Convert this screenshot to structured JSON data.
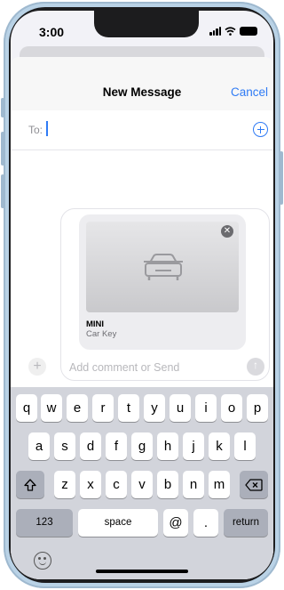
{
  "status_bar": {
    "time": "3:00"
  },
  "header": {
    "title": "New Message",
    "cancel_label": "Cancel"
  },
  "to_field": {
    "label": "To:"
  },
  "attachment": {
    "title": "MINI",
    "subtitle": "Car Key"
  },
  "composer": {
    "placeholder": "Add comment or Send"
  },
  "keyboard": {
    "row1": [
      "q",
      "w",
      "e",
      "r",
      "t",
      "y",
      "u",
      "i",
      "o",
      "p"
    ],
    "row2": [
      "a",
      "s",
      "d",
      "f",
      "g",
      "h",
      "j",
      "k",
      "l"
    ],
    "row3": [
      "z",
      "x",
      "c",
      "v",
      "b",
      "n",
      "m"
    ],
    "numbers_label": "123",
    "space_label": "space",
    "at_label": "@",
    "dot_label": ".",
    "return_label": "return"
  },
  "icons": {
    "add_contact": "plus-circle-icon",
    "car": "car-icon",
    "remove": "close-icon",
    "shift": "shift-icon",
    "delete": "backspace-icon",
    "emoji": "emoji-icon"
  },
  "colors": {
    "accent": "#2f7bf5",
    "keyboard_bg": "#d2d4db"
  }
}
